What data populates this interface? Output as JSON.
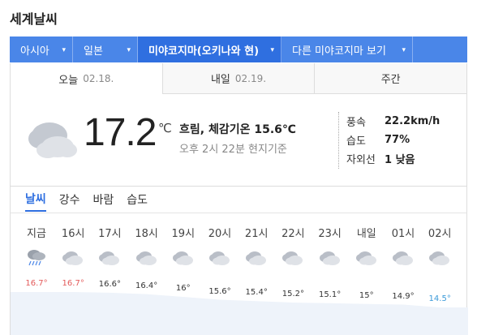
{
  "page_title": "세계날씨",
  "breadcrumb": [
    {
      "label": "아시아",
      "active": false
    },
    {
      "label": "일본",
      "active": false
    },
    {
      "label": "미야코지마(오키나와 현)",
      "active": true
    },
    {
      "label": "다른 미야코지마 보기",
      "active": false
    }
  ],
  "tabs": [
    {
      "label": "오늘",
      "date": "02.18."
    },
    {
      "label": "내일",
      "date": "02.19."
    },
    {
      "label": "주간",
      "date": ""
    }
  ],
  "current": {
    "temp": "17.2",
    "unit": "℃",
    "condition": "흐림,",
    "feels_label": "체감기온",
    "feels_value": "15.6℃",
    "updated": "오후 2시 22분 현지기준",
    "icon": "cloudy-icon",
    "stats": [
      {
        "key": "풍속",
        "value": "22.2km/h"
      },
      {
        "key": "습도",
        "value": "77%"
      },
      {
        "key": "자외선",
        "value": "1 낮음"
      }
    ]
  },
  "subtabs": [
    "날씨",
    "강수",
    "바람",
    "습도"
  ],
  "hourly": [
    {
      "time": "지금",
      "icon": "rain-icon",
      "temp": "16.7°",
      "value": 16.7,
      "tone": "warm"
    },
    {
      "time": "16시",
      "icon": "cloudy-icon",
      "temp": "16.7°",
      "value": 16.7,
      "tone": "warm"
    },
    {
      "time": "17시",
      "icon": "cloudy-icon",
      "temp": "16.6°",
      "value": 16.6,
      "tone": "normal"
    },
    {
      "time": "18시",
      "icon": "cloudy-icon",
      "temp": "16.4°",
      "value": 16.4,
      "tone": "normal"
    },
    {
      "time": "19시",
      "icon": "cloudy-icon",
      "temp": "16°",
      "value": 16.0,
      "tone": "normal"
    },
    {
      "time": "20시",
      "icon": "cloudy-icon",
      "temp": "15.6°",
      "value": 15.6,
      "tone": "normal"
    },
    {
      "time": "21시",
      "icon": "cloudy-icon",
      "temp": "15.4°",
      "value": 15.4,
      "tone": "normal"
    },
    {
      "time": "22시",
      "icon": "cloudy-icon",
      "temp": "15.2°",
      "value": 15.2,
      "tone": "normal"
    },
    {
      "time": "23시",
      "icon": "cloudy-icon",
      "temp": "15.1°",
      "value": 15.1,
      "tone": "normal"
    },
    {
      "time": "내일",
      "icon": "cloudy-icon",
      "temp": "15°",
      "value": 15.0,
      "tone": "normal"
    },
    {
      "time": "01시",
      "icon": "cloudy-icon",
      "temp": "14.9°",
      "value": 14.9,
      "tone": "normal"
    },
    {
      "time": "02시",
      "icon": "cloudy-icon",
      "temp": "14.5°",
      "value": 14.5,
      "tone": "cool"
    }
  ],
  "colors": {
    "accent": "#4a86e8",
    "accent_dark": "#2f6fe0",
    "warm": "#e35a5a",
    "cool": "#3b9ad9"
  }
}
